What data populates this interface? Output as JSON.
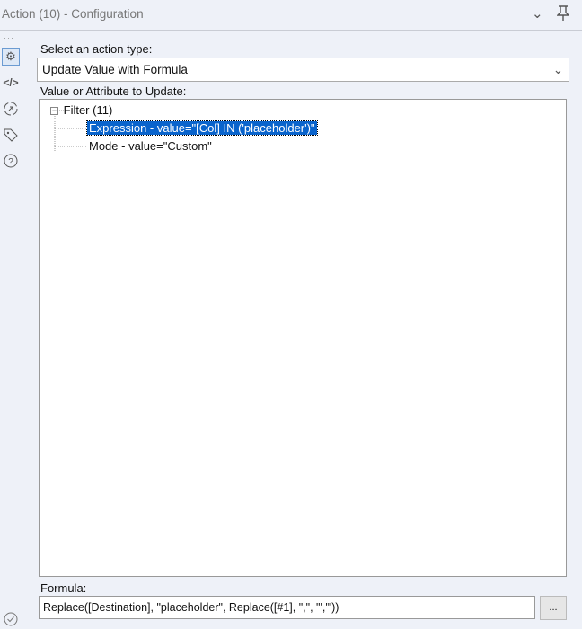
{
  "header": {
    "title": "Action (10) - Configuration"
  },
  "action_type": {
    "label": "Select an action type:",
    "value": "Update Value with Formula"
  },
  "tree": {
    "label": "Value or Attribute to Update:",
    "root": "Filter (11)",
    "children": [
      "Expression - value=\"[Col] IN ('placeholder')\"",
      "Mode - value=\"Custom\""
    ]
  },
  "formula": {
    "label": "Formula:",
    "value": "Replace([Destination], \"placeholder\", Replace([#1], \",\", \"','\"))",
    "button": "..."
  }
}
